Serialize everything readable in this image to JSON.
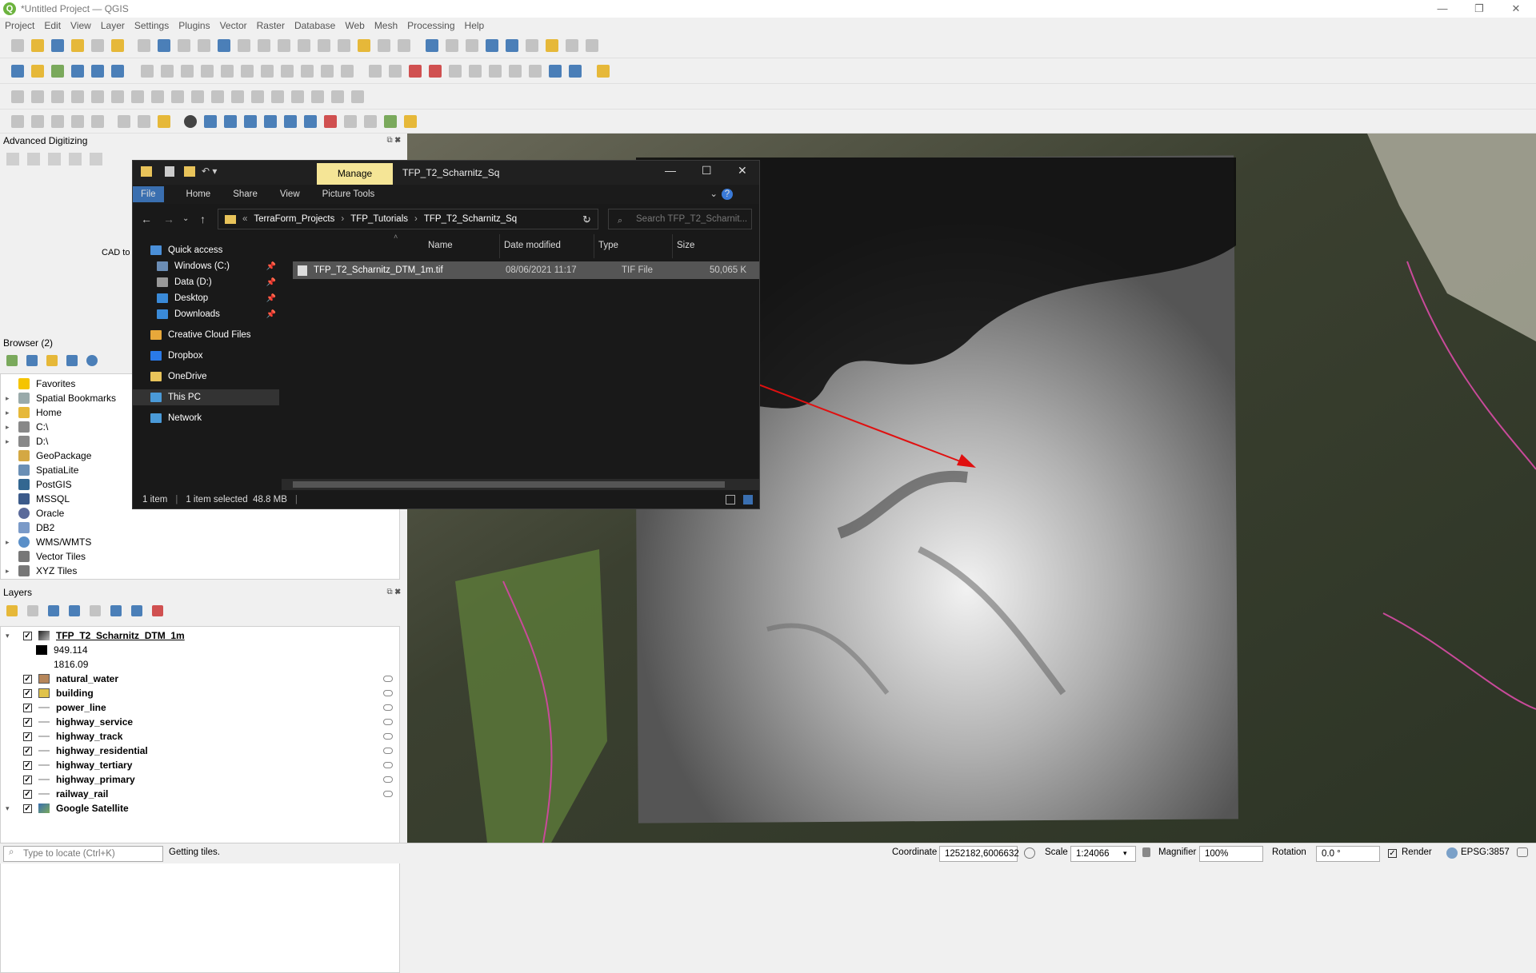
{
  "app": {
    "title": "*Untitled Project — QGIS",
    "logo": "Q"
  },
  "window_controls": {
    "minimize": "—",
    "restore": "❐",
    "close": "✕"
  },
  "menu": [
    "Project",
    "Edit",
    "View",
    "Layer",
    "Settings",
    "Plugins",
    "Vector",
    "Raster",
    "Database",
    "Web",
    "Mesh",
    "Processing",
    "Help"
  ],
  "panels": {
    "advanced_digitizing": {
      "title": "Advanced Digitizing",
      "cad_label": "CAD to"
    },
    "browser": {
      "title": "Browser (2)",
      "items": [
        {
          "label": "Favorites",
          "icon": "star-icon",
          "expand": ""
        },
        {
          "label": "Spatial Bookmarks",
          "icon": "bookmark-icon",
          "expand": "▸"
        },
        {
          "label": "Home",
          "icon": "folder-icon",
          "expand": "▸"
        },
        {
          "label": "C:\\",
          "icon": "drive-icon",
          "expand": "▸"
        },
        {
          "label": "D:\\",
          "icon": "drive-icon",
          "expand": "▸"
        },
        {
          "label": "GeoPackage",
          "icon": "geopackage-icon",
          "expand": ""
        },
        {
          "label": "SpatiaLite",
          "icon": "spatialite-icon",
          "expand": ""
        },
        {
          "label": "PostGIS",
          "icon": "postgis-icon",
          "expand": ""
        },
        {
          "label": "MSSQL",
          "icon": "mssql-icon",
          "expand": ""
        },
        {
          "label": "Oracle",
          "icon": "oracle-icon",
          "expand": ""
        },
        {
          "label": "DB2",
          "icon": "db2-icon",
          "expand": ""
        },
        {
          "label": "WMS/WMTS",
          "icon": "wms-icon",
          "expand": "▸"
        },
        {
          "label": "Vector Tiles",
          "icon": "vector-tiles-icon",
          "expand": ""
        },
        {
          "label": "XYZ Tiles",
          "icon": "xyz-tiles-icon",
          "expand": "▸"
        }
      ]
    },
    "layers": {
      "title": "Layers",
      "dtm": {
        "name": "TFP_T2_Scharnitz_DTM_1m",
        "min": "949.114",
        "max": "1816.09"
      },
      "items": [
        {
          "name": "natural_water",
          "swatch": "#b6865a",
          "kind": "fill"
        },
        {
          "name": "building",
          "swatch": "#e0c24a",
          "kind": "fill"
        },
        {
          "name": "power_line",
          "swatch": "#bbbbbb",
          "kind": "line"
        },
        {
          "name": "highway_service",
          "swatch": "#bbbbbb",
          "kind": "line"
        },
        {
          "name": "highway_track",
          "swatch": "#bbbbbb",
          "kind": "line"
        },
        {
          "name": "highway_residential",
          "swatch": "#bbbbbb",
          "kind": "line"
        },
        {
          "name": "highway_tertiary",
          "swatch": "#bbbbbb",
          "kind": "line"
        },
        {
          "name": "highway_primary",
          "swatch": "#bbbbbb",
          "kind": "line"
        },
        {
          "name": "railway_rail",
          "swatch": "#bbbbbb",
          "kind": "line"
        }
      ],
      "google": "Google Satellite"
    }
  },
  "explorer": {
    "manage_tab": "Manage",
    "title": "TFP_T2_Scharnitz_Sq",
    "ribbon": [
      "File",
      "Home",
      "Share",
      "View",
      "Picture Tools"
    ],
    "path": [
      "TerraForm_Projects",
      "TFP_Tutorials",
      "TFP_T2_Scharnitz_Sq"
    ],
    "path_prefix": "«",
    "search_placeholder": "Search TFP_T2_Scharnit...",
    "nav": [
      {
        "label": "Quick access",
        "icon": "star-icon",
        "pin": ""
      },
      {
        "label": "Windows (C:)",
        "icon": "drive-icon",
        "pin": "📌"
      },
      {
        "label": "Data (D:)",
        "icon": "drive-icon",
        "pin": "📌"
      },
      {
        "label": "Desktop",
        "icon": "desktop-icon",
        "pin": "📌"
      },
      {
        "label": "Downloads",
        "icon": "download-icon",
        "pin": "📌"
      },
      {
        "label": "Creative Cloud Files",
        "icon": "cloud-icon",
        "pin": ""
      },
      {
        "label": "Dropbox",
        "icon": "dropbox-icon",
        "pin": ""
      },
      {
        "label": "OneDrive",
        "icon": "onedrive-icon",
        "pin": ""
      },
      {
        "label": "This PC",
        "icon": "pc-icon",
        "pin": ""
      },
      {
        "label": "Network",
        "icon": "network-icon",
        "pin": ""
      }
    ],
    "columns": [
      "Name",
      "Date modified",
      "Type",
      "Size"
    ],
    "file": {
      "name": "TFP_T2_Scharnitz_DTM_1m.tif",
      "date": "08/06/2021 11:17",
      "type": "TIF File",
      "size": "50,065 K"
    },
    "status_items": "1 item",
    "status_selected": "1 item selected  48.8 MB"
  },
  "statusbar": {
    "locate_placeholder": "Type to locate (Ctrl+K)",
    "message": "Getting tiles.",
    "coordinate_label": "Coordinate",
    "coordinate": "1252182,6006632",
    "scale_label": "Scale",
    "scale": "1:24066",
    "magnifier_label": "Magnifier",
    "magnifier": "100%",
    "rotation_label": "Rotation",
    "rotation": "0.0 °",
    "render_label": "Render",
    "crs": "EPSG:3857"
  }
}
